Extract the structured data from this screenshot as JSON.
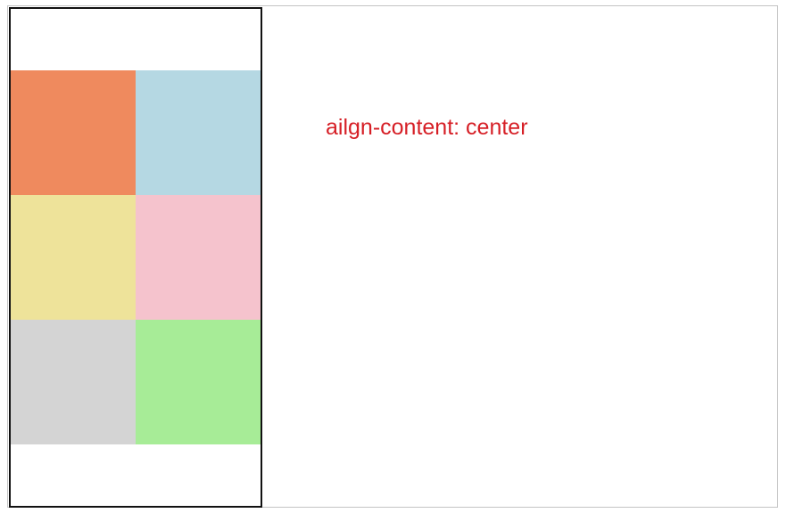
{
  "caption": "ailgn-content: center",
  "colors": {
    "caption": "#d61f26",
    "container_border": "#111111",
    "frame_border": "#c4c4c4"
  },
  "container": {
    "layout": "flex-wrap",
    "align_content": "center",
    "columns": 2
  },
  "items": [
    {
      "color": "#ef8a5e"
    },
    {
      "color": "#b5d8e3"
    },
    {
      "color": "#eee39a"
    },
    {
      "color": "#f5c3cd"
    },
    {
      "color": "#d4d4d4"
    },
    {
      "color": "#a7ec97"
    }
  ]
}
